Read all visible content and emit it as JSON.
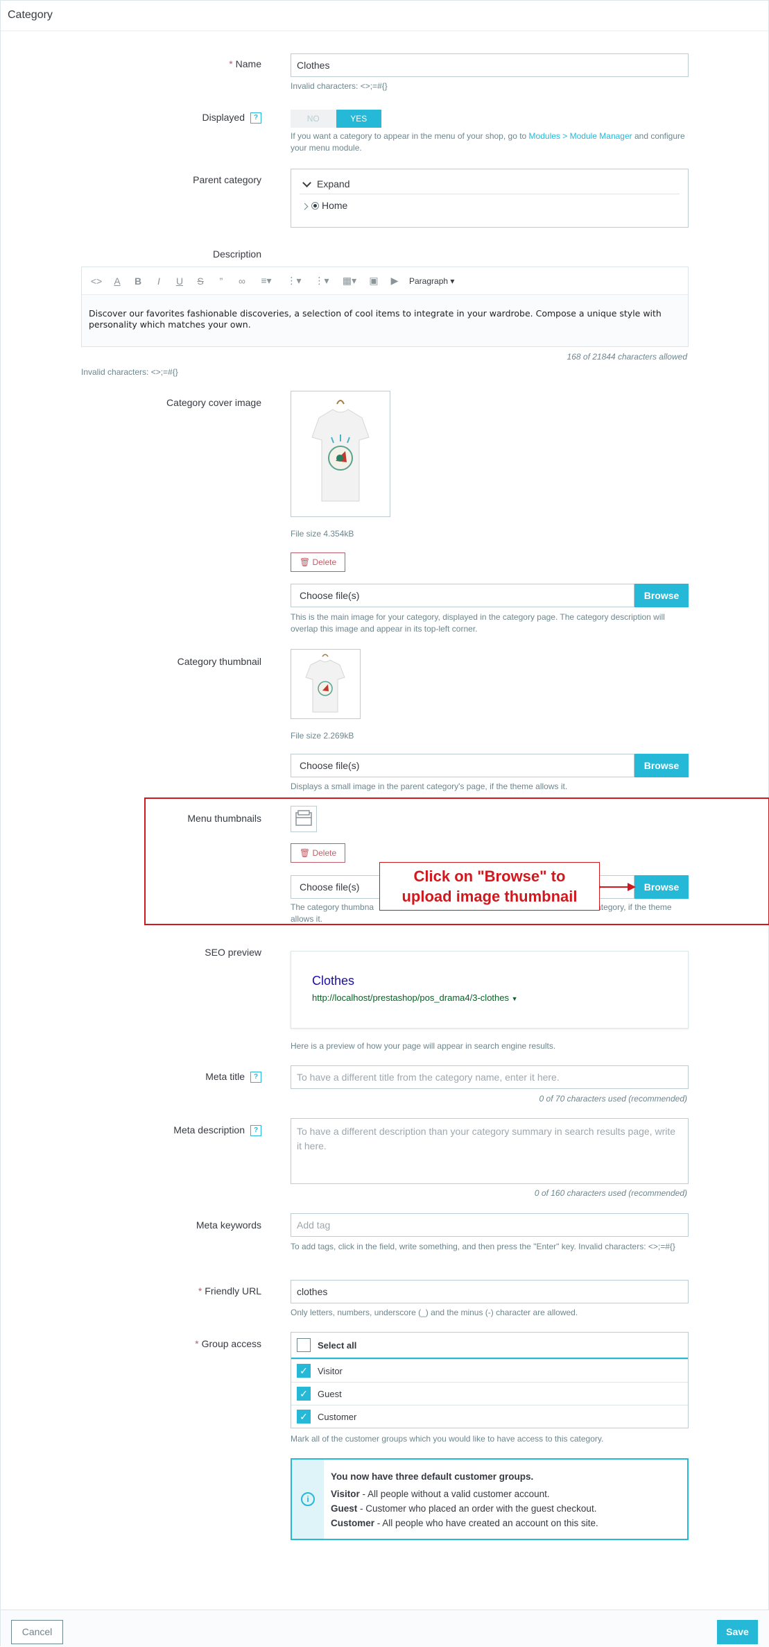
{
  "panel": {
    "title": "Category"
  },
  "name": {
    "label": "Name",
    "value": "Clothes",
    "hint": "Invalid characters: <>;=#{}"
  },
  "displayed": {
    "label": "Displayed",
    "off_label": "NO",
    "on_label": "YES",
    "hint_before": "If you want a category to appear in the menu of your shop, go to ",
    "hint_link": "Modules > Module Manager",
    "hint_after": " and configure your menu module."
  },
  "parent": {
    "label": "Parent category",
    "expand_label": "Expand",
    "home_label": "Home"
  },
  "description": {
    "label": "Description",
    "paragraph_label": "Paragraph",
    "text": "Discover our favorites fashionable discoveries, a selection of cool items to integrate in your wardrobe. Compose a unique style with personality which matches your own.",
    "counter": "168 of 21844 characters allowed",
    "invalid_hint": "Invalid characters: <>;=#{}"
  },
  "cover": {
    "label": "Category cover image",
    "file_size": "File size 4.354kB",
    "delete_label": "Delete",
    "file_placeholder": "Choose file(s)",
    "browse_label": "Browse",
    "hint": "This is the main image for your category, displayed in the category page. The category description will overlap this image and appear in its top-left corner."
  },
  "thumbnail": {
    "label": "Category thumbnail",
    "file_size": "File size 2.269kB",
    "file_placeholder": "Choose file(s)",
    "browse_label": "Browse",
    "hint": "Displays a small image in the parent category's page, if the theme allows it."
  },
  "menu_thumbnails": {
    "label": "Menu thumbnails",
    "delete_label": "Delete",
    "file_placeholder": "Choose file(s)",
    "browse_label": "Browse",
    "hint_left": "The category thumbna",
    "hint_right": "category, if the theme",
    "hint_line2": "allows it.",
    "callout_line1": "Click on \"Browse\" to",
    "callout_line2": "upload image thumbnail",
    "highlight_color": "#d0191e"
  },
  "seo": {
    "label": "SEO preview",
    "title": "Clothes",
    "url": "http://localhost/prestashop/pos_drama4/3-clothes",
    "hint": "Here is a preview of how your page will appear in search engine results."
  },
  "meta_title": {
    "label": "Meta title",
    "placeholder": "To have a different title from the category name, enter it here.",
    "counter": "0 of 70 characters used (recommended)"
  },
  "meta_description": {
    "label": "Meta description",
    "placeholder": "To have a different description than your category summary in search results page, write it here.",
    "counter": "0 of 160 characters used (recommended)"
  },
  "meta_keywords": {
    "label": "Meta keywords",
    "placeholder": "Add tag",
    "hint": "To add tags, click in the field, write something, and then press the \"Enter\" key. Invalid characters: <>;=#{}"
  },
  "friendly_url": {
    "label": "Friendly URL",
    "value": "clothes",
    "hint": "Only letters, numbers, underscore (_) and the minus (-) character are allowed."
  },
  "group_access": {
    "label": "Group access",
    "select_all": "Select all",
    "groups": [
      {
        "name": "Visitor",
        "checked": true
      },
      {
        "name": "Guest",
        "checked": true
      },
      {
        "name": "Customer",
        "checked": true
      }
    ],
    "hint": "Mark all of the customer groups which you would like to have access to this category."
  },
  "info": {
    "title": "You now have three default customer groups.",
    "lines": [
      {
        "name": "Visitor",
        "text": " - All people without a valid customer account."
      },
      {
        "name": "Guest",
        "text": " - Customer who placed an order with the guest checkout."
      },
      {
        "name": "Customer",
        "text": " - All people who have created an account on this site."
      }
    ]
  },
  "footer": {
    "cancel_label": "Cancel",
    "save_label": "Save"
  },
  "colors": {
    "accent": "#25b9d7",
    "danger": "#c05c67",
    "annotation": "#d0191e"
  }
}
